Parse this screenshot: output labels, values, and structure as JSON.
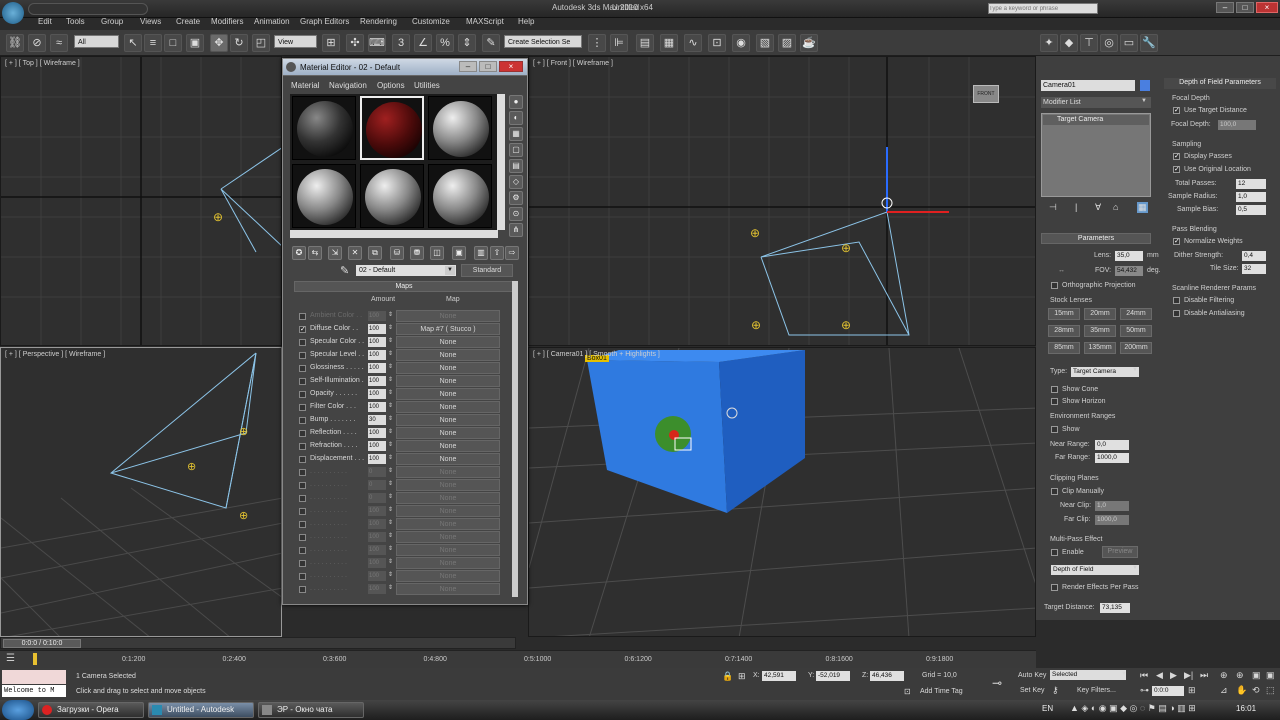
{
  "app": {
    "title": "Autodesk 3ds Max  2010 x64",
    "file": "Untitled",
    "search_placeholder": "Type a keyword or phrase"
  },
  "menu": [
    "Edit",
    "Tools",
    "Group",
    "Views",
    "Create",
    "Modifiers",
    "Animation",
    "Graph Editors",
    "Rendering",
    "Customize",
    "MAXScript",
    "Help"
  ],
  "toolbar": {
    "filter": "All",
    "ref_coord": "View",
    "selection_set": "Create Selection Se"
  },
  "viewports": {
    "top": "[ + ] [ Top ] [ Wireframe ]",
    "front": "[ + ] [ Front ] [ Wireframe ]",
    "perspective": "[ + ] [ Perspective ] [ Wireframe ]",
    "camera": "[ + ] [ Camera01 ] [ Smooth + Highlights ]",
    "camera_short": "Camera01",
    "box_tag": "Box01"
  },
  "material_editor": {
    "title": "Material Editor - 02 - Default",
    "menus": [
      "Material",
      "Navigation",
      "Options",
      "Utilities"
    ],
    "material_name": "02 - Default",
    "material_type": "Standard",
    "maps_header": "Maps",
    "col_amount": "Amount",
    "col_map": "Map",
    "maps": [
      {
        "name": "Ambient Color . .",
        "amount": "100",
        "map": "None",
        "checked": false,
        "dim": true
      },
      {
        "name": "Diffuse Color . .",
        "amount": "100",
        "map": "Map #7  ( Stucco )",
        "checked": true,
        "dim": false
      },
      {
        "name": "Specular Color . .",
        "amount": "100",
        "map": "None",
        "checked": false,
        "dim": false
      },
      {
        "name": "Specular Level . .",
        "amount": "100",
        "map": "None",
        "checked": false,
        "dim": false
      },
      {
        "name": "Glossiness . . . . .",
        "amount": "100",
        "map": "None",
        "checked": false,
        "dim": false
      },
      {
        "name": "Self-Illumination .",
        "amount": "100",
        "map": "None",
        "checked": false,
        "dim": false
      },
      {
        "name": "Opacity . . . . . .",
        "amount": "100",
        "map": "None",
        "checked": false,
        "dim": false
      },
      {
        "name": "Filter Color . . .",
        "amount": "100",
        "map": "None",
        "checked": false,
        "dim": false
      },
      {
        "name": "Bump . . . . . . .",
        "amount": "30",
        "map": "None",
        "checked": false,
        "dim": false
      },
      {
        "name": "Reflection . . . .",
        "amount": "100",
        "map": "None",
        "checked": false,
        "dim": false
      },
      {
        "name": "Refraction . . . .",
        "amount": "100",
        "map": "None",
        "checked": false,
        "dim": false
      },
      {
        "name": "Displacement . . .",
        "amount": "100",
        "map": "None",
        "checked": false,
        "dim": false
      },
      {
        "name": ". . . . . . . . . .",
        "amount": "0",
        "map": "None",
        "checked": false,
        "dim": true
      },
      {
        "name": ". . . . . . . . . .",
        "amount": "0",
        "map": "None",
        "checked": false,
        "dim": true
      },
      {
        "name": ". . . . . . . . . .",
        "amount": "0",
        "map": "None",
        "checked": false,
        "dim": true
      },
      {
        "name": ". . . . . . . . . .",
        "amount": "100",
        "map": "None",
        "checked": false,
        "dim": true
      },
      {
        "name": ". . . . . . . . . .",
        "amount": "100",
        "map": "None",
        "checked": false,
        "dim": true
      },
      {
        "name": ". . . . . . . . . .",
        "amount": "100",
        "map": "None",
        "checked": false,
        "dim": true
      },
      {
        "name": ". . . . . . . . . .",
        "amount": "100",
        "map": "None",
        "checked": false,
        "dim": true
      },
      {
        "name": ". . . . . . . . . .",
        "amount": "100",
        "map": "None",
        "checked": false,
        "dim": true
      },
      {
        "name": ". . . . . . . . . .",
        "amount": "100",
        "map": "None",
        "checked": false,
        "dim": true
      },
      {
        "name": ". . . . . . . . . .",
        "amount": "100",
        "map": "None",
        "checked": false,
        "dim": true
      }
    ]
  },
  "command_panel": {
    "object_name": "Camera01",
    "modifier_list": "Modifier List",
    "stack_item": "Target Camera",
    "parameters_header": "Parameters",
    "lens_label": "Lens:",
    "lens_value": "35,0",
    "lens_unit": "mm",
    "fov_label": "FOV:",
    "fov_value": "54,432",
    "fov_unit": "deg.",
    "ortho": "Orthographic Projection",
    "stock_lenses": "Stock Lenses",
    "lenses": [
      "15mm",
      "20mm",
      "24mm",
      "28mm",
      "35mm",
      "50mm",
      "85mm",
      "135mm",
      "200mm"
    ],
    "type_label": "Type:",
    "type_value": "Target Camera",
    "show_cone": "Show Cone",
    "show_horizon": "Show Horizon",
    "env_ranges": "Environment Ranges",
    "env_show": "Show",
    "near_range_label": "Near Range:",
    "near_range": "0,0",
    "far_range_label": "Far Range:",
    "far_range": "1000,0",
    "clipping": "Clipping Planes",
    "clip_manually": "Clip Manually",
    "near_clip_label": "Near Clip:",
    "near_clip": "1,0",
    "far_clip_label": "Far Clip:",
    "far_clip": "1000,0",
    "multipass": "Multi-Pass Effect",
    "enable": "Enable",
    "preview": "Preview",
    "effect": "Depth of Field",
    "render_effects": "Render Effects Per Pass",
    "target_distance_label": "Target Distance:",
    "target_distance": "73,135"
  },
  "dof_panel": {
    "header": "Depth of Field Parameters",
    "focal_depth": "Focal Depth",
    "use_target": "Use Target Distance",
    "focal_depth_label": "Focal Depth:",
    "focal_depth_value": "100,0",
    "sampling": "Sampling",
    "display_passes": "Display Passes",
    "use_original": "Use Original Location",
    "total_passes_label": "Total Passes:",
    "total_passes": "12",
    "sample_radius_label": "Sample Radius:",
    "sample_radius": "1,0",
    "sample_bias_label": "Sample Bias:",
    "sample_bias": "0,5",
    "pass_blending": "Pass Blending",
    "normalize": "Normalize Weights",
    "dither_label": "Dither Strength:",
    "dither": "0,4",
    "tile_label": "Tile Size:",
    "tile": "32",
    "scanline": "Scanline Renderer Params",
    "disable_filtering": "Disable Filtering",
    "disable_aa": "Disable Antialiasing"
  },
  "timeline": {
    "frame": "0 / 100",
    "ticks": [
      "0:1:200",
      "0:2:400",
      "0:3:600",
      "0:4:800",
      "0:5:1000",
      "0:6:1200",
      "0:7:1400",
      "0:8:1600",
      "0:9:1800"
    ],
    "time_display": "0:0:0 / 0:10:0"
  },
  "status": {
    "listener": "Welcome to M",
    "selection": "1 Camera Selected",
    "prompt": "Click and drag to select and move objects",
    "x_label": "X:",
    "x": "42,591",
    "y_label": "Y:",
    "y": "-52,019",
    "z_label": "Z:",
    "z": "46,436",
    "grid": "Grid = 10,0",
    "add_time_tag": "Add Time Tag",
    "auto_key": "Auto Key",
    "set_key": "Set Key",
    "selected": "Selected",
    "key_filters": "Key Filters...",
    "frame": "0:0:0"
  },
  "taskbar": {
    "start": "",
    "items": [
      "Загрузки - Opera",
      "Untitled - Autodesk",
      "ЭР - Окно чата"
    ],
    "lang": "EN",
    "clock": "16:01"
  }
}
